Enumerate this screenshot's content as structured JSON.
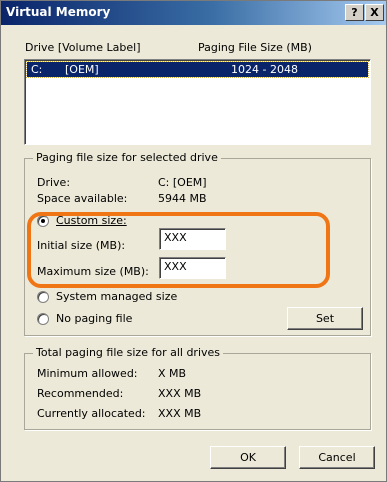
{
  "window": {
    "title": "Virtual Memory",
    "help_label": "?",
    "close_label": "X"
  },
  "drives": {
    "column_drive": "Drive  [Volume Label]",
    "column_paging": "Paging File Size (MB)",
    "rows": [
      {
        "drive": "C:",
        "label": "[OEM]",
        "size": "1024 - 2048"
      }
    ]
  },
  "selected_drive_group": {
    "caption": "Paging file size for selected drive",
    "drive_label": "Drive:",
    "drive_value": "C:  [OEM]",
    "space_label": "Space available:",
    "space_value": "5944 MB",
    "custom_size_label": "Custom size:",
    "initial_size_label": "Initial size (MB):",
    "initial_size_value": "XXX",
    "maximum_size_label": "Maximum size (MB):",
    "maximum_size_value": "XXX",
    "system_managed_label": "System managed size",
    "no_paging_label": "No paging file",
    "set_button": "Set",
    "selected_option": "custom"
  },
  "total_group": {
    "caption": "Total paging file size for all drives",
    "minimum_label": "Minimum allowed:",
    "minimum_value": "X MB",
    "recommended_label": "Recommended:",
    "recommended_value": "XXX MB",
    "allocated_label": "Currently allocated:",
    "allocated_value": "XXX MB"
  },
  "buttons": {
    "ok": "OK",
    "cancel": "Cancel"
  },
  "colors": {
    "highlight": "#f07515",
    "selection": "#0a246a",
    "dialog_bg": "#ece9d8"
  }
}
